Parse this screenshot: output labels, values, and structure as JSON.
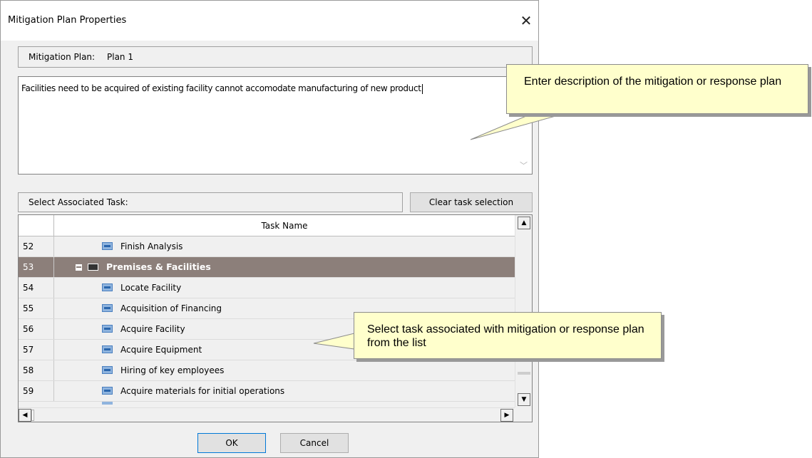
{
  "dialog": {
    "title": "Mitigation Plan Properties",
    "close_glyph": "✕"
  },
  "plan": {
    "label": "Mitigation Plan:",
    "value": "Plan 1"
  },
  "description": {
    "text": "Facilities need to be acquired of existing facility cannot accomodate manufacturing of new product"
  },
  "task_section": {
    "label": "Select Associated Task:",
    "clear_label": "Clear task selection",
    "column_header": "Task Name",
    "rows": [
      {
        "num": "52",
        "name": "Finish Analysis"
      },
      {
        "num": "53",
        "name": "Premises & Facilities",
        "summary": true
      },
      {
        "num": "54",
        "name": "Locate Facility"
      },
      {
        "num": "55",
        "name": "Acquisition of Financing"
      },
      {
        "num": "56",
        "name": "Acquire Facility"
      },
      {
        "num": "57",
        "name": "Acquire Equipment"
      },
      {
        "num": "58",
        "name": "Hiring of key employees"
      },
      {
        "num": "59",
        "name": "Acquire materials for initial operations"
      }
    ]
  },
  "buttons": {
    "ok": "OK",
    "cancel": "Cancel"
  },
  "callouts": {
    "description_hint": "Enter description of the mitigation or response plan",
    "task_hint": "Select task associated with mitigation or response plan from the list"
  },
  "colors": {
    "summary_row": "#8c7f7a",
    "callout_fill": "#ffffcc",
    "task_icon": "#8fb4de"
  }
}
